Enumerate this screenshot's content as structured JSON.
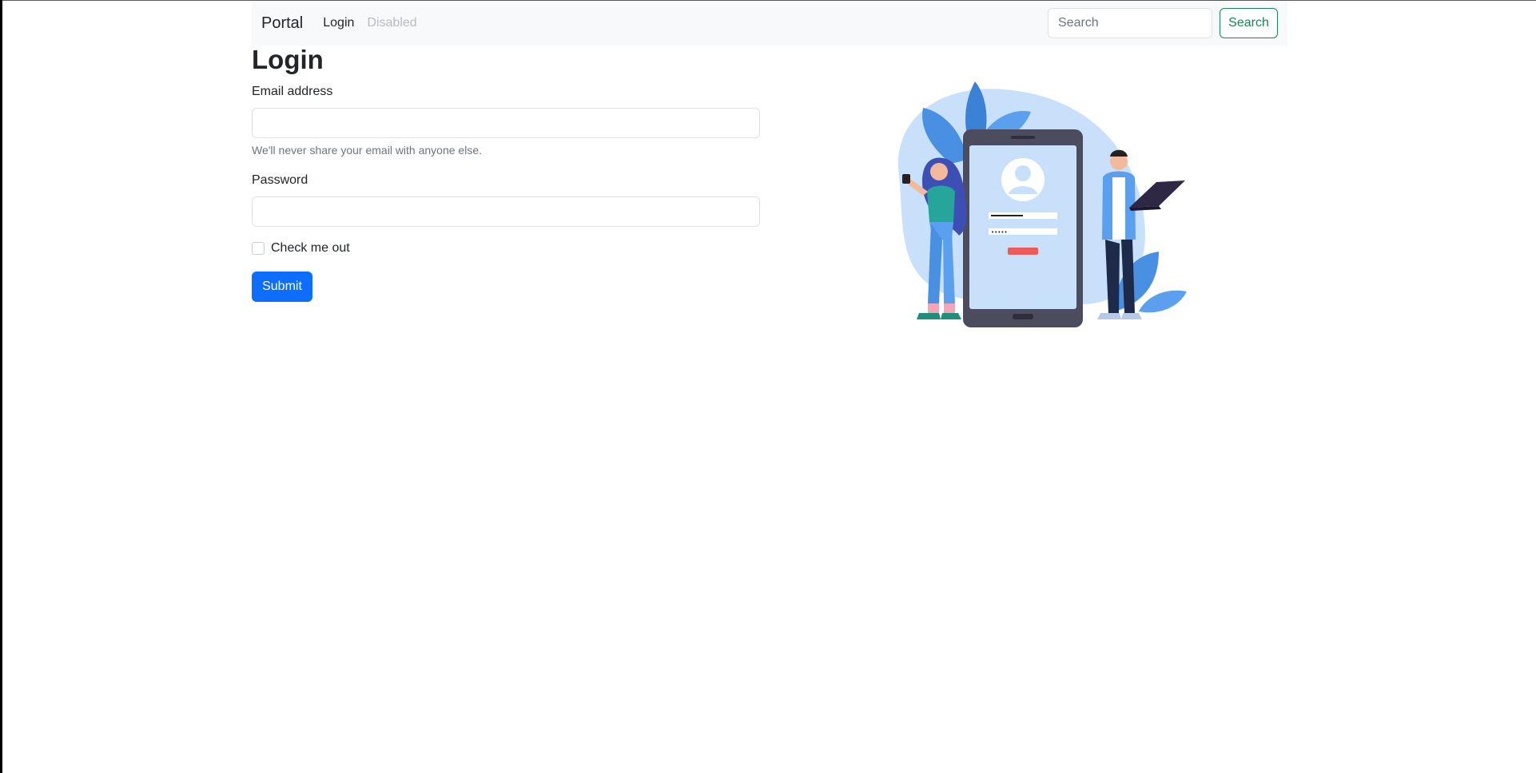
{
  "navbar": {
    "brand": "Portal",
    "links": [
      {
        "label": "Login",
        "state": "active"
      },
      {
        "label": "Disabled",
        "state": "disabled"
      }
    ],
    "search": {
      "placeholder": "Search",
      "value": "",
      "button_label": "Search"
    }
  },
  "form": {
    "title": "Login",
    "email": {
      "label": "Email address",
      "value": "",
      "help": "We'll never share your email with anyone else."
    },
    "password": {
      "label": "Password",
      "value": ""
    },
    "checkbox": {
      "label": "Check me out",
      "checked": false
    },
    "submit_label": "Submit"
  },
  "colors": {
    "primary": "#0d6efd",
    "success": "#198754",
    "navbar_bg": "#f8f9fa",
    "text": "#212529",
    "muted": "#6c757d"
  },
  "icons": {
    "illustration": "login-illustration"
  }
}
